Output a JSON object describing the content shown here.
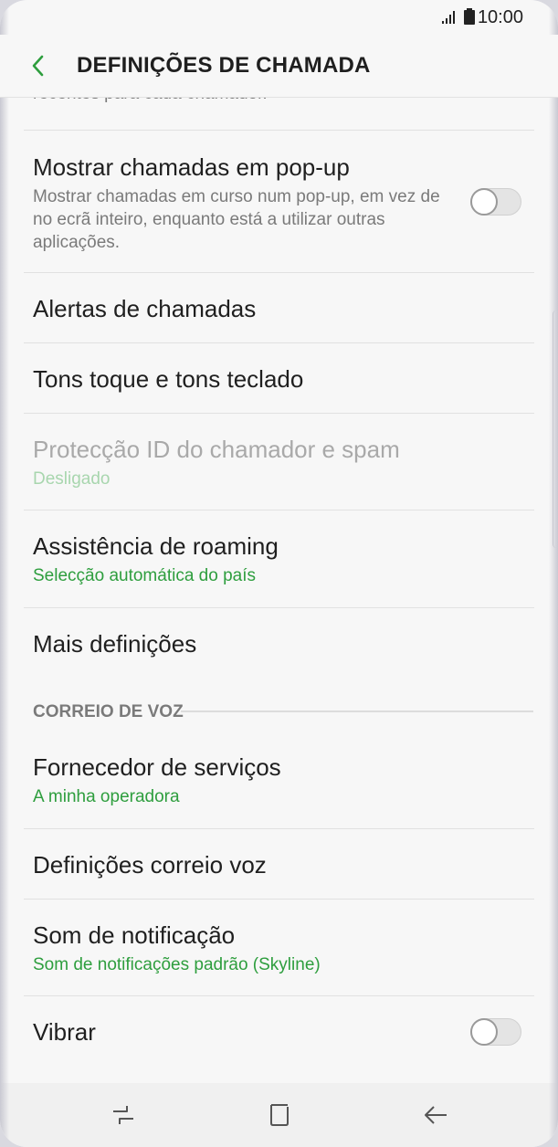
{
  "status_bar": {
    "time": "10:00",
    "icons": [
      "signal-icon",
      "battery-icon"
    ]
  },
  "app_bar": {
    "title": "DEFINIÇÕES DE CHAMADA",
    "back_icon": "chevron-left-icon",
    "accent_color": "#2e9e3e"
  },
  "partial_text": "recentes para cada chamador.",
  "items": [
    {
      "title": "Mostrar chamadas em pop-up",
      "description": "Mostrar chamadas em curso num pop-up, em vez de no ecrã inteiro, enquanto está a utilizar outras aplicações.",
      "toggle": false
    },
    {
      "title": "Alertas de chamadas"
    },
    {
      "title": "Tons toque e tons teclado"
    },
    {
      "title": "Protecção ID do chamador e spam",
      "subtitle": "Desligado",
      "disabled": true
    },
    {
      "title": "Assistência de roaming",
      "subtitle": "Selecção automática do país"
    },
    {
      "title": "Mais definições"
    }
  ],
  "voicemail_section": {
    "header": "CORREIO DE VOZ",
    "items": [
      {
        "title": "Fornecedor de serviços",
        "subtitle": "A minha operadora"
      },
      {
        "title": "Definições correio voz"
      },
      {
        "title": "Som de notificação",
        "subtitle": "Som de notificações padrão (Skyline)"
      },
      {
        "title": "Vibrar",
        "toggle": false
      }
    ]
  },
  "nav_bar": {
    "buttons": [
      "recent-apps-icon",
      "home-icon",
      "back-arrow-icon"
    ]
  }
}
